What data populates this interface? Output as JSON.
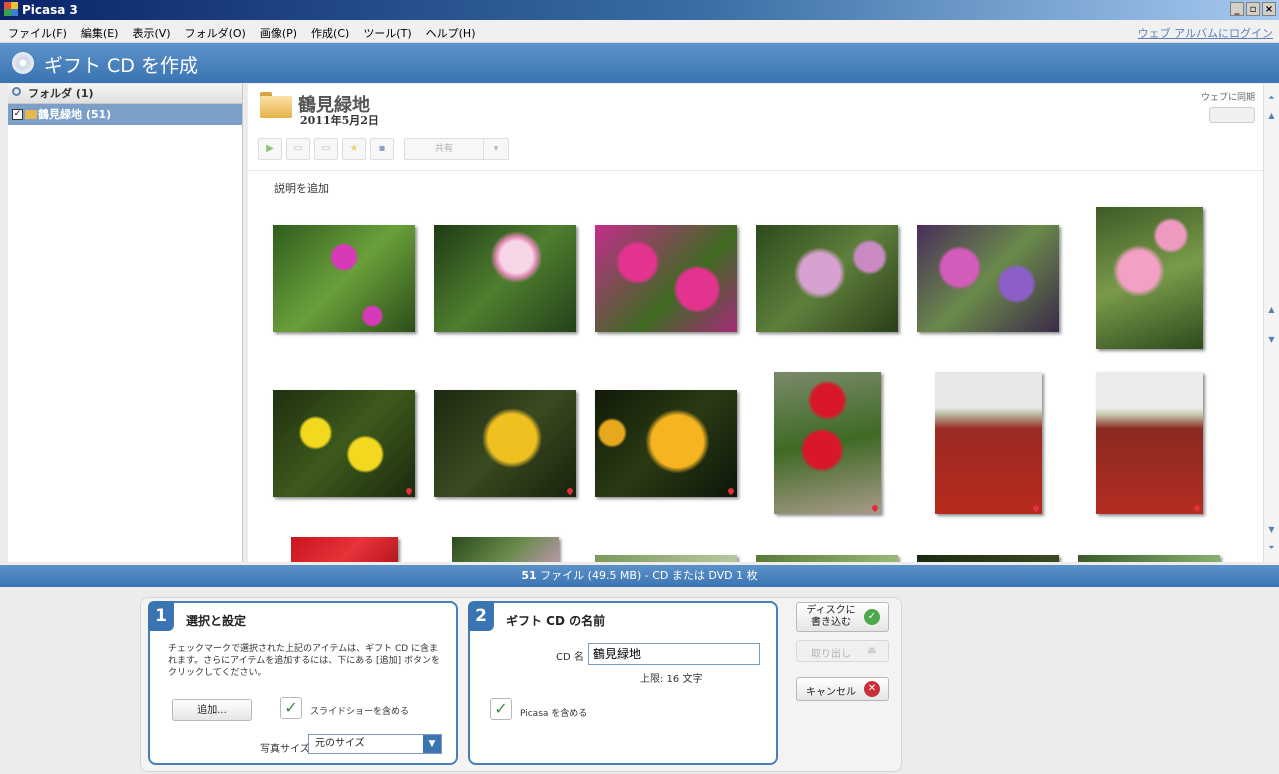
{
  "window": {
    "title": "Picasa 3"
  },
  "menu": {
    "items": [
      "ファイル(F)",
      "編集(E)",
      "表示(V)",
      "フォルダ(O)",
      "画像(P)",
      "作成(C)",
      "ツール(T)",
      "ヘルプ(H)"
    ],
    "login_link": "ウェブ アルバムにログイン"
  },
  "banner": {
    "title": "ギフト CD を作成"
  },
  "sidebar": {
    "header": "フォルダ (1)",
    "folder": {
      "name": "鶴見緑地 (51)",
      "checked": true
    }
  },
  "album": {
    "title": "鶴見緑地",
    "date": "2011年5月2日",
    "sync_label": "ウェブに同期",
    "share_label": "共有",
    "caption_placeholder": "説明を追加"
  },
  "status": {
    "files": "51",
    "text": "ファイル (49.5 MB) - CD または DVD 1 枚"
  },
  "step1": {
    "number": "1",
    "title": "選択と設定",
    "description": "チェックマークで選択された上記のアイテムは、ギフト CD に含まれます。さらにアイテムを追加するには、下にある [追加] ボタンをクリックしてください。",
    "add_button": "追加...",
    "slideshow_label": "スライドショーを含める",
    "slideshow_checked": true,
    "photo_size_label": "写真サイズ",
    "photo_size_value": "元のサイズ"
  },
  "step2": {
    "number": "2",
    "title": "ギフト CD の名前",
    "cd_name_label": "CD 名",
    "cd_name_value": "鶴見緑地",
    "limit_text": "上限: 16 文字",
    "picasa_label": "Picasa を含める",
    "picasa_checked": true
  },
  "actions": {
    "burn": "ディスクに書き込む",
    "eject": "取り出し",
    "cancel": "キャンセル"
  },
  "colors": {
    "accent": "#3a74b2",
    "selection": "#7aa0c8",
    "burn_icon": "#4ca84c",
    "cancel_icon": "#c8313a"
  }
}
